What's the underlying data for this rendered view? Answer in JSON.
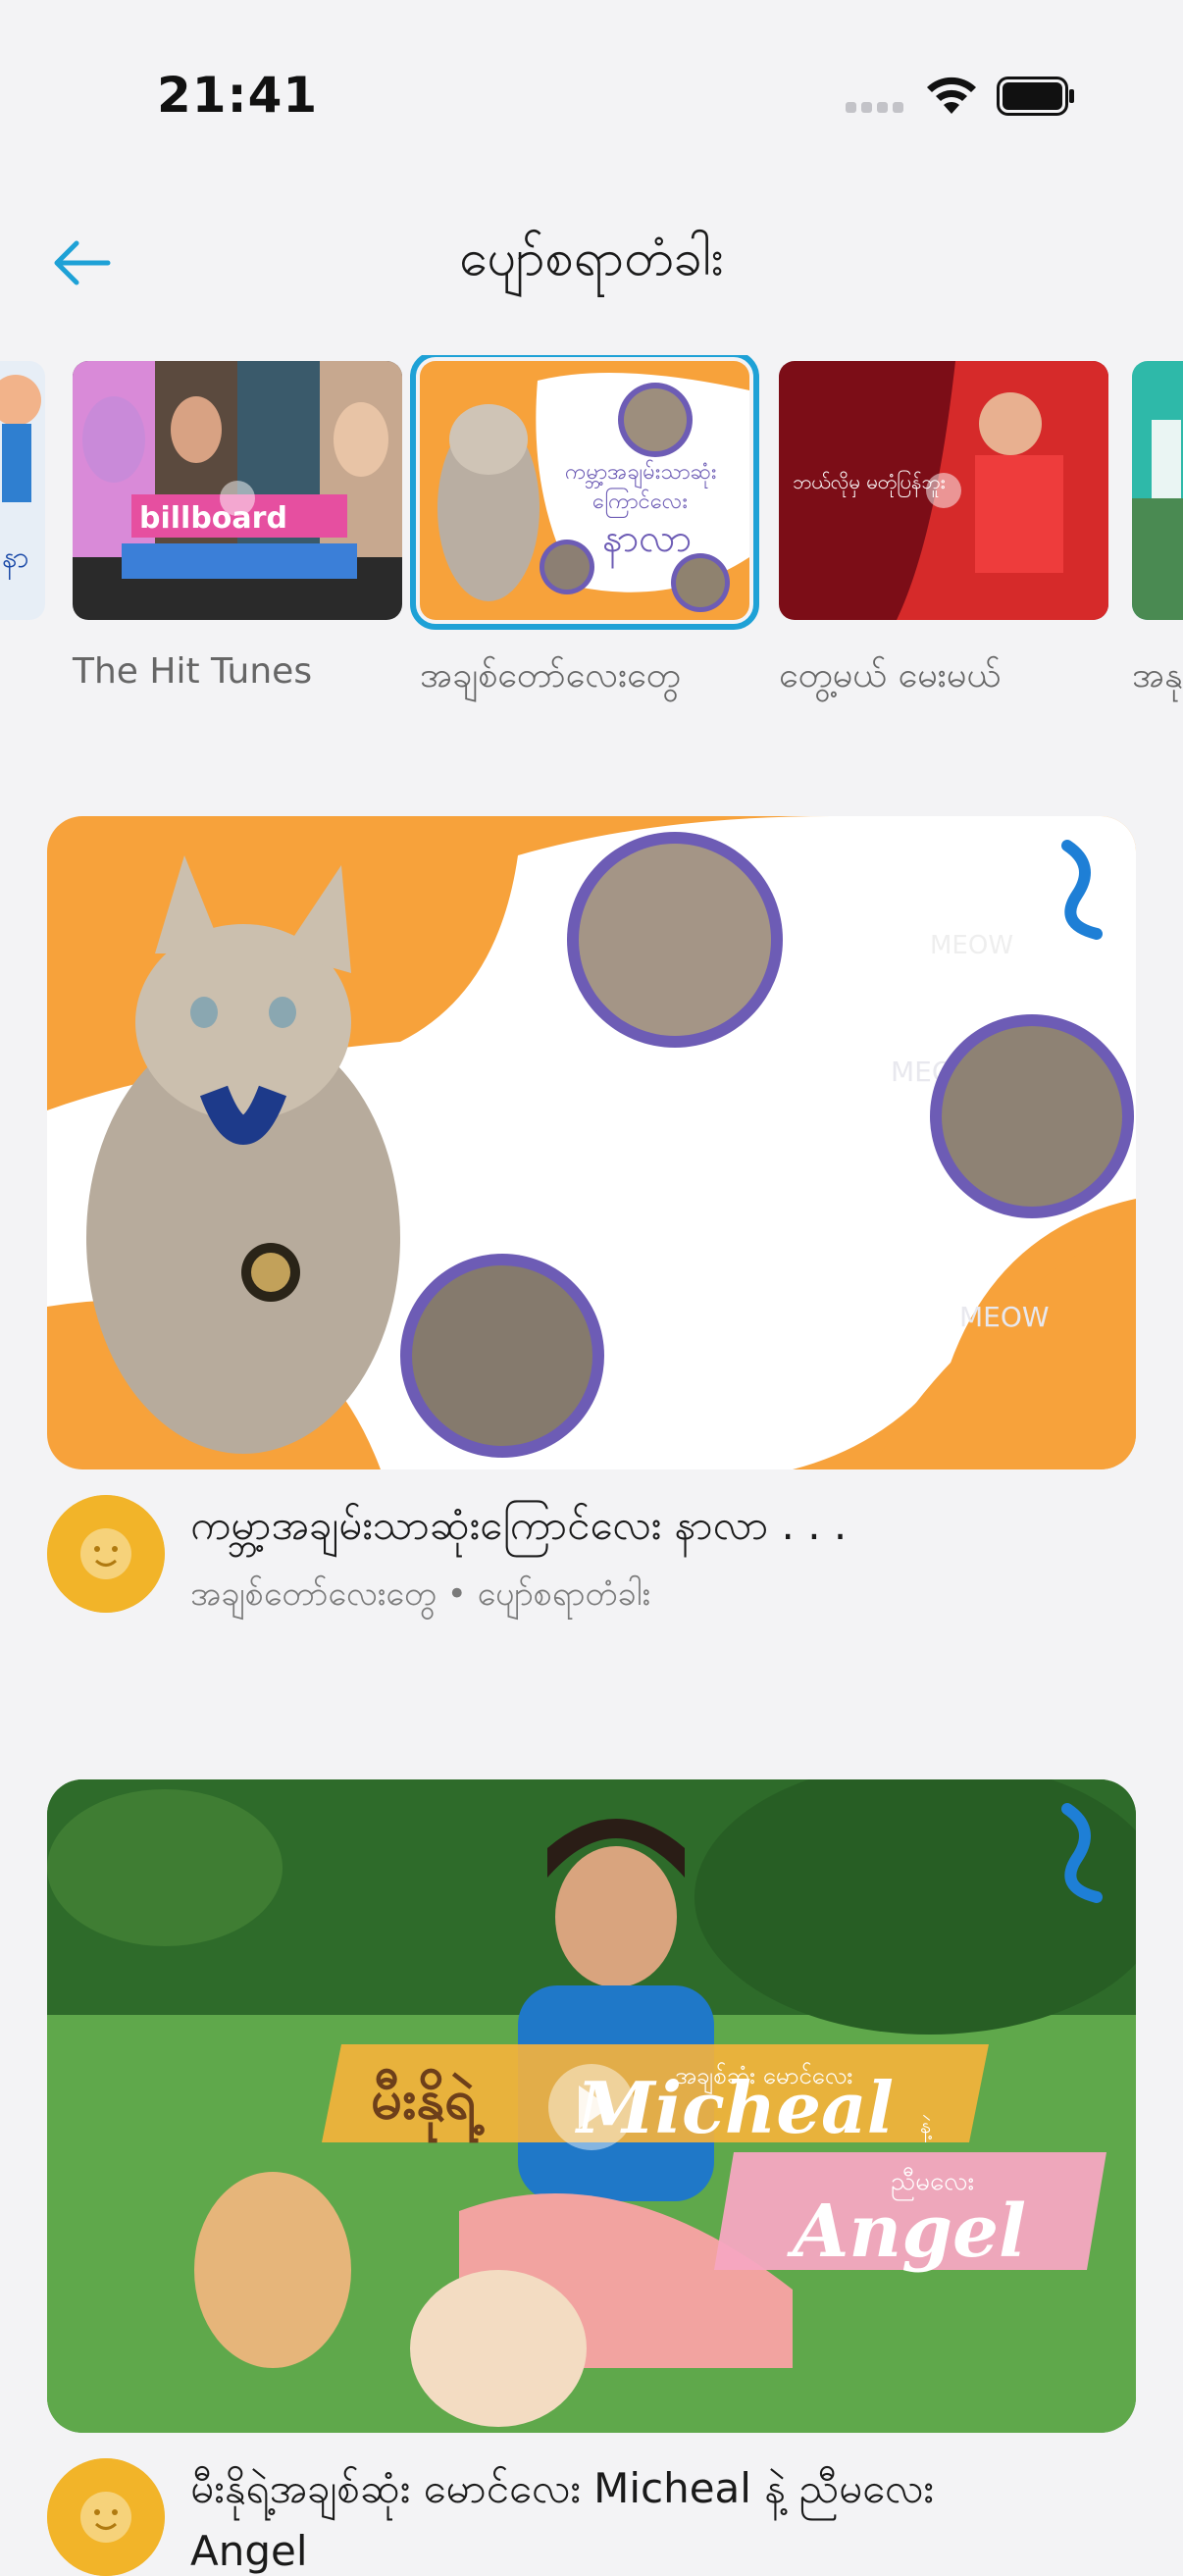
{
  "status_bar": {
    "time": "21:41",
    "icons": [
      "signal-dots-icon",
      "wifi-icon",
      "battery-icon"
    ]
  },
  "header": {
    "back_icon": "arrow-left-icon",
    "title": "ပျော်စရာတံခါး"
  },
  "carousel": {
    "items": [
      {
        "label": "",
        "icon": "partial-thumbnail"
      },
      {
        "label": "The Hit Tunes",
        "thumb_text": "billboard"
      },
      {
        "label": "အချစ်တော်လေးတွေ",
        "selected": true,
        "thumb_text": "ကမ္ဘာ့အချမ်းသာဆုံး ကြောင်လေး နာလာ"
      },
      {
        "label": "တွေ့မယ် မေးမယ်",
        "thumb_text": "ဘယ်လိုမှ မတုံပြန်ဘူး"
      },
      {
        "label": "အနု",
        "thumb_text": ""
      }
    ]
  },
  "feed": {
    "items": [
      {
        "title": "ကမ္ဘာ့အချမ်းသာဆုံးကြောင်လေး နာလာ . . .",
        "subtitle": "အချစ်တော်လေးတွေ • ပျော်စရာတံခါး",
        "banner_text_1": "ကမ္ဘာ့အချမ်းသာဆုံး",
        "banner_text_2": "ကြောင်လေး",
        "banner_text_3": "နာလာ",
        "watermark": "MEOW"
      },
      {
        "title": "မီးနိုရဲ့အချစ်ဆုံး မောင်လေး Micheal နဲ့ ညီမလေး",
        "title_line2": "Angel",
        "banner_text_1": "မီးနိုရဲ့",
        "banner_text_2": "အချစ်ဆုံး မောင်လေး",
        "banner_text_3": "Micheal",
        "banner_text_4": "နဲ့",
        "banner_text_5": "ညီမလေး",
        "banner_text_6": "Angel"
      }
    ]
  },
  "colors": {
    "accent": "#1ea1d6",
    "orange": "#f7a23b",
    "purple": "#6d5cb5",
    "pink": "#f6a6c1",
    "avatar": "#f2b429"
  }
}
